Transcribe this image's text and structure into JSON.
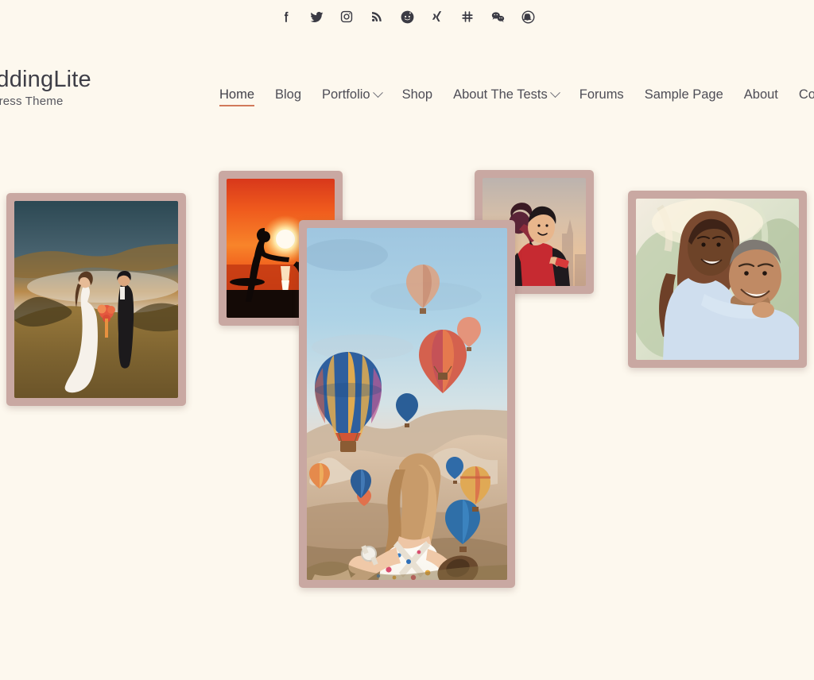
{
  "theme": {
    "background": "#fdf8ee",
    "accent": "#d2795a",
    "frame_color": "#c9a8a2",
    "text_color": "#4a4a52"
  },
  "social_bar": {
    "items": [
      {
        "name": "facebook-icon",
        "label": "Facebook"
      },
      {
        "name": "twitter-icon",
        "label": "Twitter"
      },
      {
        "name": "instagram-icon",
        "label": "Instagram"
      },
      {
        "name": "rss-icon",
        "label": "RSS"
      },
      {
        "name": "reddit-icon",
        "label": "Reddit"
      },
      {
        "name": "xing-icon",
        "label": "XING"
      },
      {
        "name": "slack-icon",
        "label": "Slack"
      },
      {
        "name": "wechat-icon",
        "label": "WeChat"
      },
      {
        "name": "snapchat-icon",
        "label": "Snapchat"
      }
    ]
  },
  "brand": {
    "title": "WeddingLite",
    "tagline": "WordPress Theme"
  },
  "nav": {
    "items": [
      {
        "label": "Home",
        "active": true,
        "has_dropdown": false
      },
      {
        "label": "Blog",
        "active": false,
        "has_dropdown": false
      },
      {
        "label": "Portfolio",
        "active": false,
        "has_dropdown": true
      },
      {
        "label": "Shop",
        "active": false,
        "has_dropdown": false
      },
      {
        "label": "About The Tests",
        "active": false,
        "has_dropdown": true
      },
      {
        "label": "Forums",
        "active": false,
        "has_dropdown": false
      },
      {
        "label": "Sample Page",
        "active": false,
        "has_dropdown": false
      },
      {
        "label": "About",
        "active": false,
        "has_dropdown": false
      },
      {
        "label": "Contacts",
        "active": false,
        "has_dropdown": false
      }
    ]
  },
  "gallery": {
    "photos": [
      {
        "name": "photo-wedding-couple-field",
        "alt": "Bride and groom facing each other in a golden field at sunset"
      },
      {
        "name": "photo-sunset-silhouette",
        "alt": "Silhouetted couple dancing on the beach at orange sunset"
      },
      {
        "name": "photo-city-selfie",
        "alt": "Smiling couple in red jackets hugging with a city skyline behind"
      },
      {
        "name": "photo-balloons-cappadocia",
        "alt": "Woman in a floral dress leading by the hand under hot air balloons"
      },
      {
        "name": "photo-couple-embrace",
        "alt": "Couple laughing outdoors, woman hugging man from behind"
      }
    ]
  }
}
